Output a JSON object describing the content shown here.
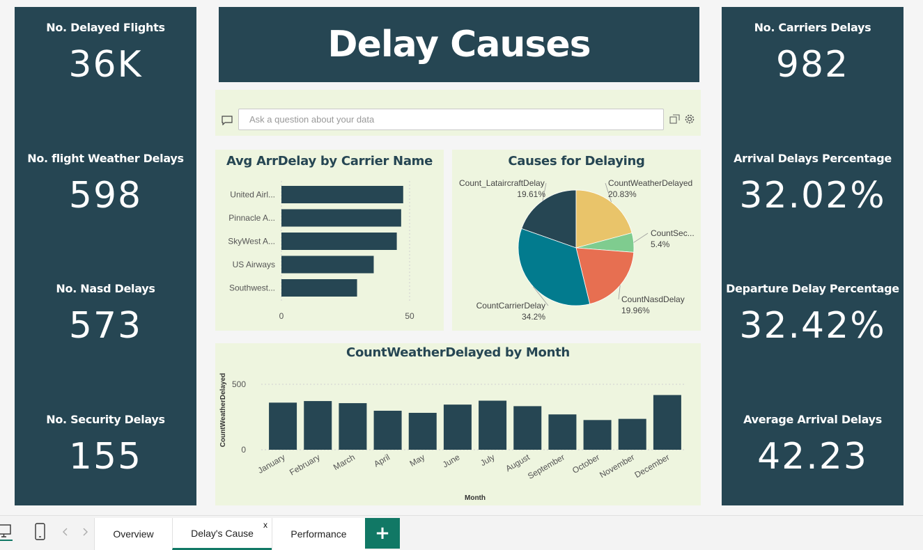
{
  "colors": {
    "dark": "#264653",
    "panel_bg": "#eef5df",
    "teal": "#117865",
    "pie": [
      "#264653",
      "#e9c46a",
      "#7fcc8f",
      "#e76f51",
      "#027b8e"
    ]
  },
  "title": "Delay Causes",
  "kpis_left": [
    {
      "label": "No. Delayed Flights",
      "value": "36K"
    },
    {
      "label": "No. flight Weather Delays",
      "value": "598"
    },
    {
      "label": "No. Nasd Delays",
      "value": "573"
    },
    {
      "label": "No. Security Delays",
      "value": "155"
    }
  ],
  "kpis_right": [
    {
      "label": "No. Carriers Delays",
      "value": "982"
    },
    {
      "label": "Arrival Delays Percentage",
      "value": "32.02%"
    },
    {
      "label": "Departure Delay Percentage",
      "value": "32.42%"
    },
    {
      "label": "Average Arrival Delays",
      "value": "42.23"
    }
  ],
  "qa": {
    "placeholder": "Ask a question about your data"
  },
  "icons": [
    "chat-icon",
    "share-icon",
    "gear-icon",
    "desktop-icon",
    "phone-icon",
    "prev-arrow-icon",
    "next-arrow-icon",
    "plus-icon"
  ],
  "chart_data": [
    {
      "type": "bar",
      "orientation": "horizontal",
      "title": "Avg ArrDelay by Carrier Name",
      "categories": [
        "United Airl...",
        "Pinnacle A...",
        "SkyWest A...",
        "US Airways",
        "Southwest..."
      ],
      "values": [
        47.5,
        46.7,
        45,
        36,
        29.5
      ],
      "xlim": [
        0,
        50
      ],
      "xticks": [
        "0",
        "50"
      ],
      "grid": true
    },
    {
      "type": "pie",
      "title": "Causes for Delaying",
      "slices": [
        {
          "name": "Count_LataircraftDelay",
          "pct": "19.61%",
          "value": 19.61
        },
        {
          "name": "CountWeatherDelayed",
          "pct": "20.83%",
          "value": 20.83
        },
        {
          "name": "CountSec...",
          "pct": "5.4%",
          "value": 5.4
        },
        {
          "name": "CountNasdDelay",
          "pct": "19.96%",
          "value": 19.96
        },
        {
          "name": "CountCarrierDelay",
          "pct": "34.2%",
          "value": 34.2
        }
      ]
    },
    {
      "type": "bar",
      "title": "CountWeatherDelayed by Month",
      "xlabel": "Month",
      "ylabel": "CountWeatherDelayed",
      "categories": [
        "January",
        "February",
        "March",
        "April",
        "May",
        "June",
        "July",
        "August",
        "September",
        "October",
        "November",
        "December"
      ],
      "values": [
        360,
        372,
        356,
        298,
        282,
        345,
        375,
        333,
        270,
        227,
        236,
        418
      ],
      "ylim": [
        0,
        500
      ],
      "yticks": [
        "500",
        "0"
      ],
      "grid": true
    }
  ],
  "tabs": {
    "items": [
      {
        "label": "Overview"
      },
      {
        "label": "Delay's Cause",
        "active": true,
        "close": "x"
      },
      {
        "label": "Performance"
      }
    ],
    "add_label": "+"
  }
}
